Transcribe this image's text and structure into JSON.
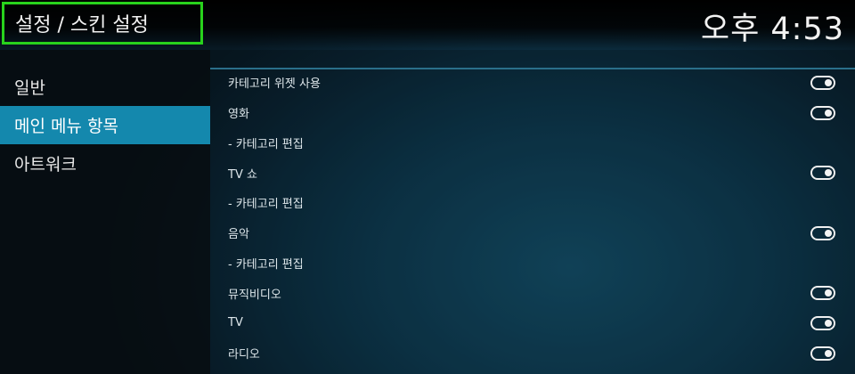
{
  "header": {
    "title": "설정 / 스킨 설정",
    "clock": "오후 4:53"
  },
  "sidebar": {
    "items": [
      {
        "label": "일반",
        "active": false
      },
      {
        "label": "메인 메뉴 항목",
        "active": true
      },
      {
        "label": "아트워크",
        "active": false
      }
    ]
  },
  "settings": {
    "rows": [
      {
        "label": "카테고리 위젯 사용",
        "toggle": true,
        "on": true
      },
      {
        "label": "영화",
        "toggle": true,
        "on": true
      },
      {
        "label": "- 카테고리 편집",
        "toggle": false
      },
      {
        "label": "TV 쇼",
        "toggle": true,
        "on": true
      },
      {
        "label": "- 카테고리 편집",
        "toggle": false
      },
      {
        "label": "음악",
        "toggle": true,
        "on": true
      },
      {
        "label": "- 카테고리 편집",
        "toggle": false
      },
      {
        "label": "뮤직비디오",
        "toggle": true,
        "on": true
      },
      {
        "label": "TV",
        "toggle": true,
        "on": true
      },
      {
        "label": "라디오",
        "toggle": true,
        "on": true
      }
    ]
  },
  "colors": {
    "accent": "#1488ad",
    "highlight_border": "#28d21c"
  }
}
